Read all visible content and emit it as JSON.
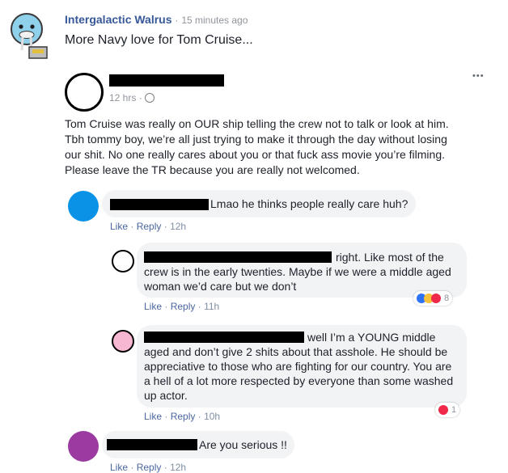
{
  "header": {
    "author": "Intergalactic Walrus",
    "dot": "·",
    "time": "15 minutes ago",
    "caption": "More Navy love for Tom Cruise..."
  },
  "shared_post": {
    "time": "12 hrs",
    "dot": "·",
    "menu": "•••",
    "body_lines": [
      "Tom Cruise was really on OUR ship telling the crew not to talk or look at him.",
      "Tbh tommy boy, we’re all just trying to make it through the day without losing",
      "our shit. No one really cares about you or that fuck ass movie you’re filming.",
      "Please leave the TR because you are really not welcomed."
    ]
  },
  "comments": [
    {
      "text": "Lmao he thinks people really care huh?",
      "like": "Like",
      "reply": "Reply",
      "dot": "·",
      "time": "12h",
      "avatar_color": "#0a93e6"
    },
    {
      "lines": [
        "right. Like most of the",
        "crew is in the early twenties. Maybe if we were a middle aged",
        "woman we’d care but we don’t"
      ],
      "like": "Like",
      "reply": "Reply",
      "dot": "·",
      "time": "11h",
      "reaction_count": "8",
      "avatar_color": "#ffffff"
    },
    {
      "lines": [
        "well I’m a YOUNG middle",
        "aged and don’t give 2 shits about that asshole. He should be",
        "appreciative to those who are fighting for our country. You are",
        "a hell of a lot more respected by everyone than some washed",
        "up actor."
      ],
      "like": "Like",
      "reply": "Reply",
      "dot": "·",
      "time": "10h",
      "reaction_count": "1",
      "avatar_color": "#f7b6d2"
    },
    {
      "text": "Are you serious !!",
      "like": "Like",
      "reply": "Reply",
      "dot": "·",
      "time": "12h",
      "avatar_color": "#9b3aa0"
    }
  ],
  "colors": {
    "link_blue": "#365899",
    "meta_gray": "#90949c",
    "bubble_bg": "#f2f3f5",
    "like_blue": "#2f73f5",
    "love_red": "#f0284a",
    "haha_yellow": "#f7c23a"
  }
}
